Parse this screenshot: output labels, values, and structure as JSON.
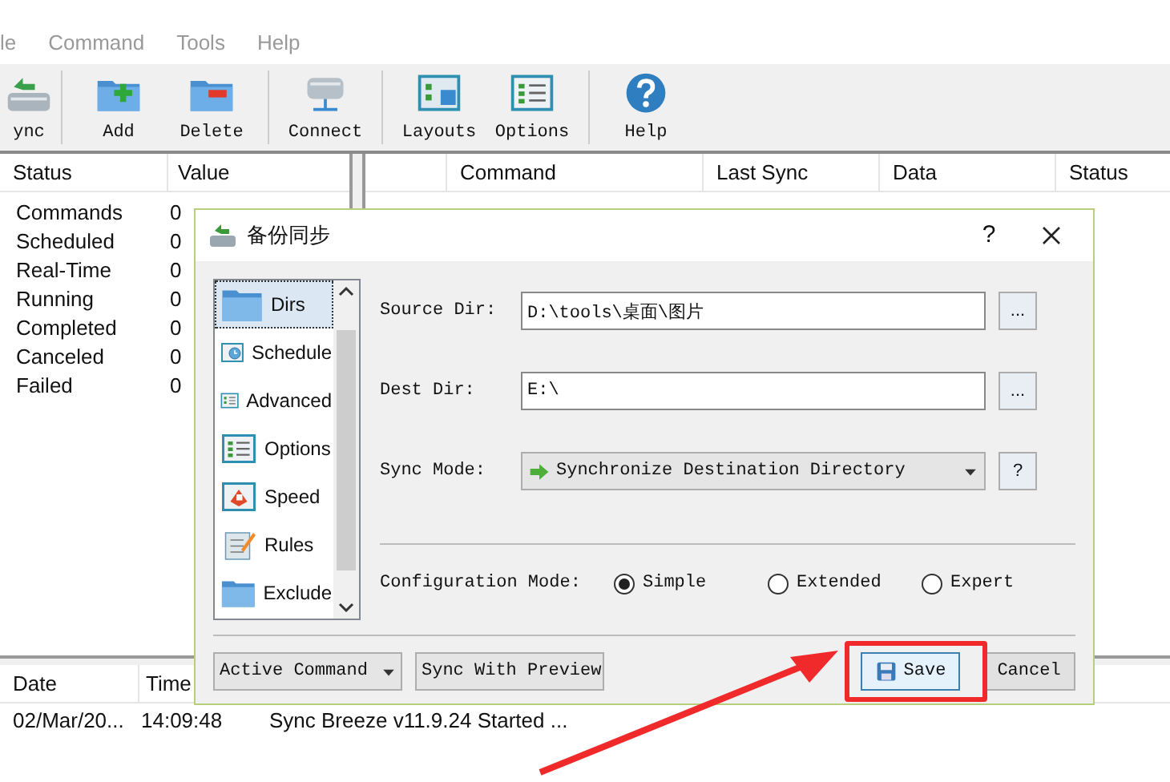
{
  "menu": [
    "le",
    "Command",
    "Tools",
    "Help"
  ],
  "toolbar": [
    [
      {
        "label": "ync"
      }
    ],
    [
      {
        "label": "Add"
      },
      {
        "label": "Delete"
      }
    ],
    [
      {
        "label": "Connect"
      }
    ],
    [
      {
        "label": "Layouts"
      },
      {
        "label": "Options"
      }
    ],
    [
      {
        "label": "Help"
      }
    ]
  ],
  "status_table": {
    "columns": [
      "Status",
      "Value"
    ],
    "rows": [
      [
        "Commands",
        "0"
      ],
      [
        "Scheduled",
        "0"
      ],
      [
        "Real-Time",
        "0"
      ],
      [
        "Running",
        "0"
      ],
      [
        "Completed",
        "0"
      ],
      [
        "Canceled",
        "0"
      ],
      [
        "Failed",
        "0"
      ]
    ]
  },
  "commands_table": {
    "columns": [
      "Command",
      "Last Sync",
      "Data",
      "Status"
    ]
  },
  "log": {
    "columns": [
      "Date",
      "Time"
    ],
    "rows": [
      {
        "date": "02/Mar/20...",
        "time": "14:09:48",
        "message": "Sync Breeze v11.9.24 Started ..."
      }
    ]
  },
  "dialog": {
    "title": "备份同步",
    "help": "?",
    "sidebar": [
      {
        "label": "Dirs",
        "selected": true
      },
      {
        "label": "Schedule",
        "selected": false
      },
      {
        "label": "Advanced",
        "selected": false
      },
      {
        "label": "Options",
        "selected": false
      },
      {
        "label": "Speed",
        "selected": false
      },
      {
        "label": "Rules",
        "selected": false
      },
      {
        "label": "Exclude",
        "selected": false
      }
    ],
    "fields": [
      {
        "label": "Source Dir:",
        "value": "D:\\tools\\桌面\\图片",
        "button": "..."
      },
      {
        "label": "Dest Dir:",
        "value": "E:\\",
        "button": "..."
      }
    ],
    "sync_mode": {
      "label": "Sync Mode:",
      "value": "Synchronize Destination Directory",
      "help": "?"
    },
    "config_mode": {
      "label": "Configuration Mode:",
      "options": [
        {
          "label": "Simple",
          "selected": true
        },
        {
          "label": "Extended",
          "selected": false
        },
        {
          "label": "Expert",
          "selected": false
        }
      ]
    },
    "footer": {
      "dropdowns": [
        "Active Command",
        "Sync With Preview"
      ],
      "save": "Save",
      "cancel": "Cancel"
    }
  }
}
